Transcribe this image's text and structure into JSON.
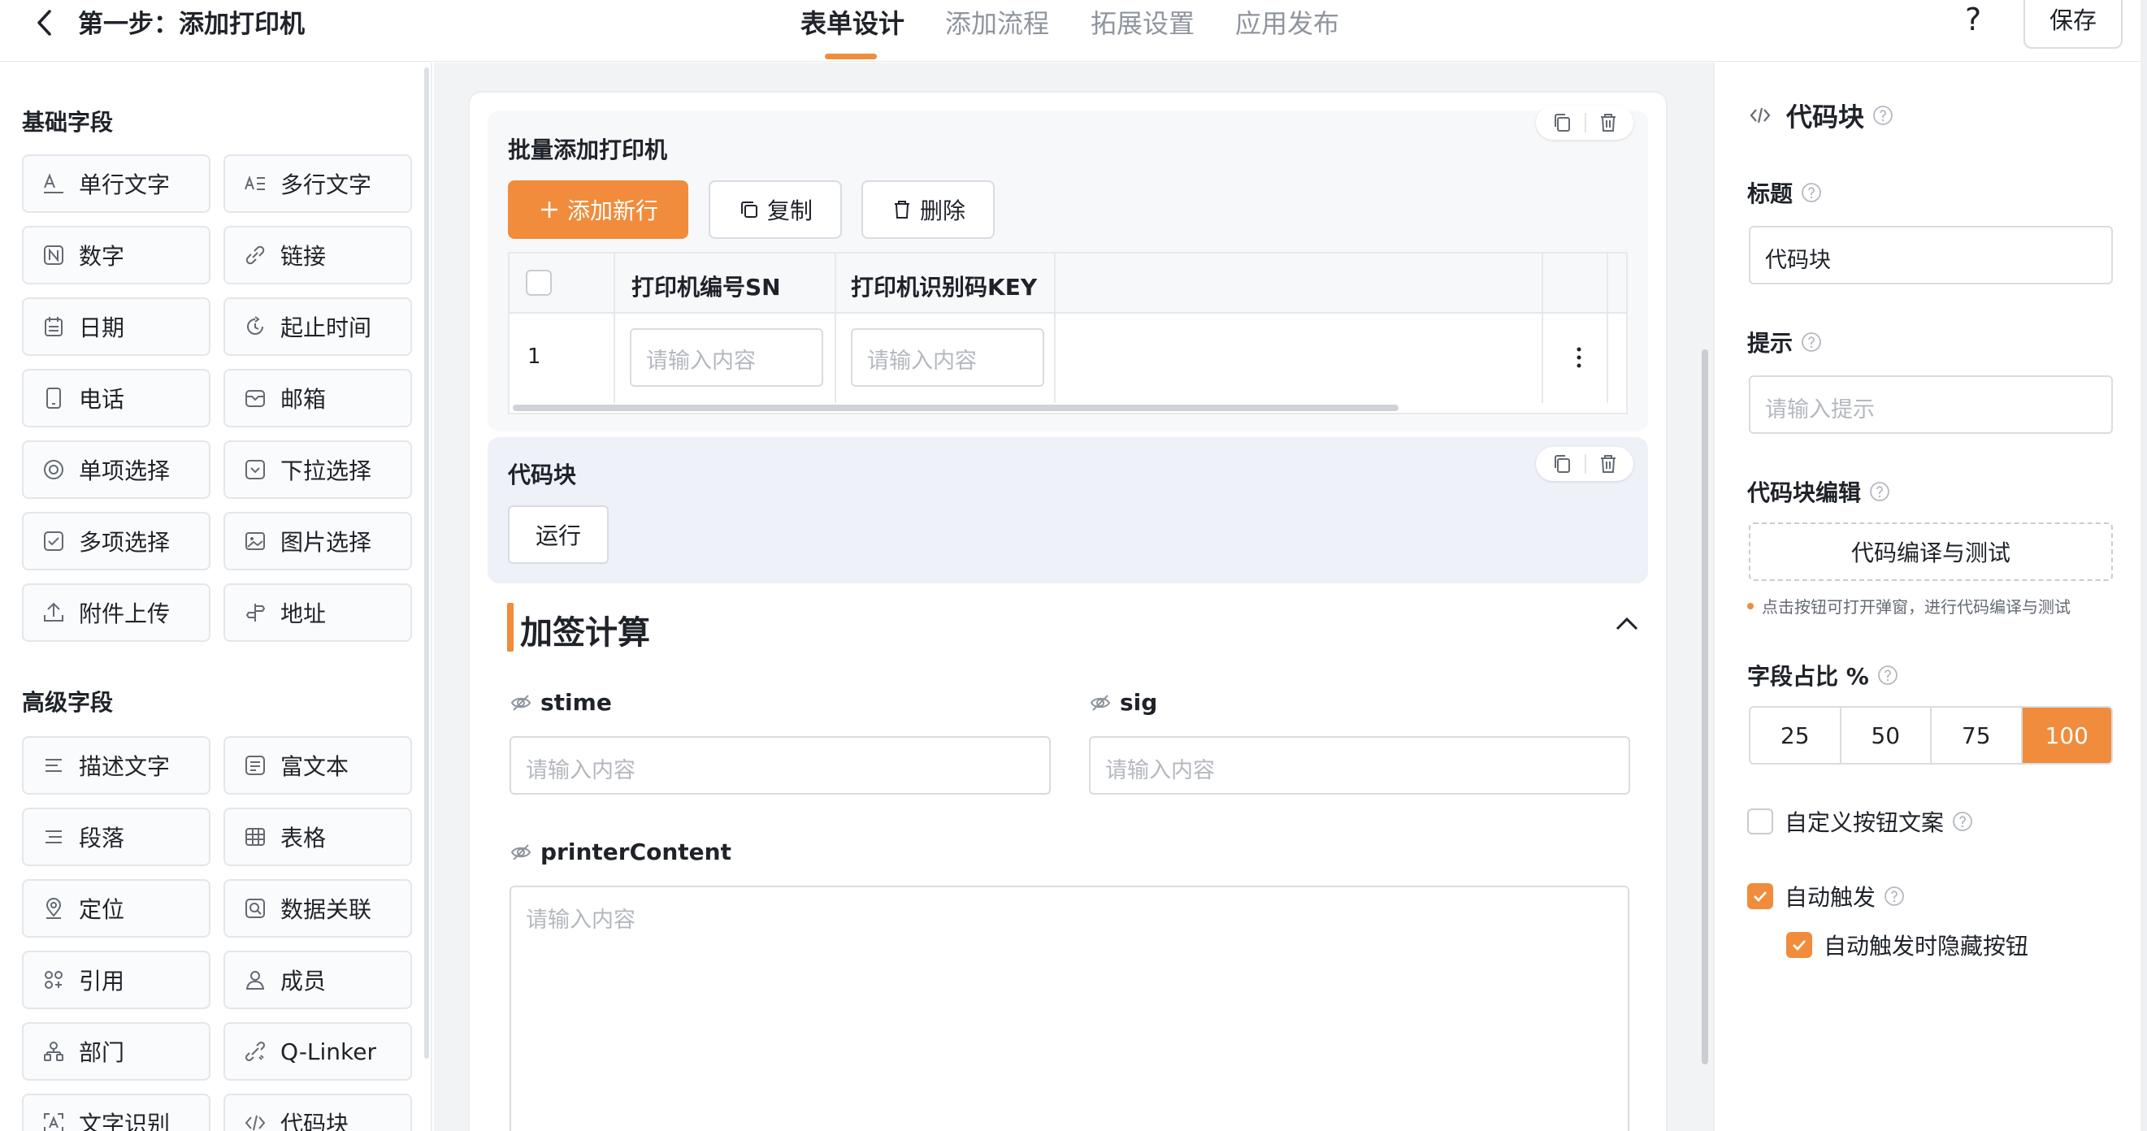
{
  "header": {
    "title": "第一步：添加打印机",
    "tabs": [
      {
        "label": "表单设计",
        "active": true
      },
      {
        "label": "添加流程",
        "active": false
      },
      {
        "label": "拓展设置",
        "active": false
      },
      {
        "label": "应用发布",
        "active": false
      }
    ],
    "help_label": "?",
    "save_label": "保存",
    "accent_color": "#f08c3c"
  },
  "palette": {
    "basic_title": "基础字段",
    "basic_fields": [
      {
        "label": "单行文字",
        "icon": "single-line-text-icon"
      },
      {
        "label": "多行文字",
        "icon": "multi-line-text-icon"
      },
      {
        "label": "数字",
        "icon": "number-icon"
      },
      {
        "label": "链接",
        "icon": "link-icon"
      },
      {
        "label": "日期",
        "icon": "calendar-icon"
      },
      {
        "label": "起止时间",
        "icon": "time-range-icon"
      },
      {
        "label": "电话",
        "icon": "phone-icon"
      },
      {
        "label": "邮箱",
        "icon": "mail-icon"
      },
      {
        "label": "单项选择",
        "icon": "radio-icon"
      },
      {
        "label": "下拉选择",
        "icon": "dropdown-icon"
      },
      {
        "label": "多项选择",
        "icon": "checkbox-icon"
      },
      {
        "label": "图片选择",
        "icon": "image-icon"
      },
      {
        "label": "附件上传",
        "icon": "upload-icon"
      },
      {
        "label": "地址",
        "icon": "address-icon"
      }
    ],
    "advanced_title": "高级字段",
    "advanced_fields": [
      {
        "label": "描述文字",
        "icon": "description-icon"
      },
      {
        "label": "富文本",
        "icon": "rich-text-icon"
      },
      {
        "label": "段落",
        "icon": "paragraph-icon"
      },
      {
        "label": "表格",
        "icon": "table-icon"
      },
      {
        "label": "定位",
        "icon": "location-icon"
      },
      {
        "label": "数据关联",
        "icon": "data-link-icon"
      },
      {
        "label": "引用",
        "icon": "reference-icon"
      },
      {
        "label": "成员",
        "icon": "member-icon"
      },
      {
        "label": "部门",
        "icon": "department-icon"
      },
      {
        "label": "Q-Linker",
        "icon": "q-linker-icon"
      },
      {
        "label": "文字识别",
        "icon": "ocr-icon"
      },
      {
        "label": "代码块",
        "icon": "code-icon"
      }
    ]
  },
  "canvas": {
    "batch_block": {
      "title": "批量添加打印机",
      "add_row_label": "添加新行",
      "copy_label": "复制",
      "delete_label": "删除",
      "columns": [
        "打印机编号SN",
        "打印机识别码KEY"
      ],
      "rows": [
        {
          "index": "1",
          "placeholders": [
            "请输入内容",
            "请输入内容"
          ]
        }
      ]
    },
    "code_block": {
      "title": "代码块",
      "run_label": "运行"
    },
    "group": {
      "title": "加签计算",
      "fields": [
        {
          "label": "stime",
          "placeholder": "请输入内容"
        },
        {
          "label": "sig",
          "placeholder": "请输入内容"
        },
        {
          "label": "printerContent",
          "placeholder": "请输入内容"
        }
      ]
    }
  },
  "properties": {
    "component_name": "代码块",
    "title_label": "标题",
    "title_value": "代码块",
    "hint_label": "提示",
    "hint_placeholder": "请输入提示",
    "code_edit_label": "代码块编辑",
    "code_edit_button": "代码编译与测试",
    "code_edit_hint": "点击按钮可打开弹窗，进行代码编译与测试",
    "width_label": "字段占比 %",
    "width_options": [
      "25",
      "50",
      "75",
      "100"
    ],
    "width_selected": "100",
    "custom_button_text_label": "自定义按钮文案",
    "custom_button_text_checked": false,
    "auto_trigger_label": "自动触发",
    "auto_trigger_checked": true,
    "hide_button_label": "自动触发时隐藏按钮",
    "hide_button_checked": true
  }
}
